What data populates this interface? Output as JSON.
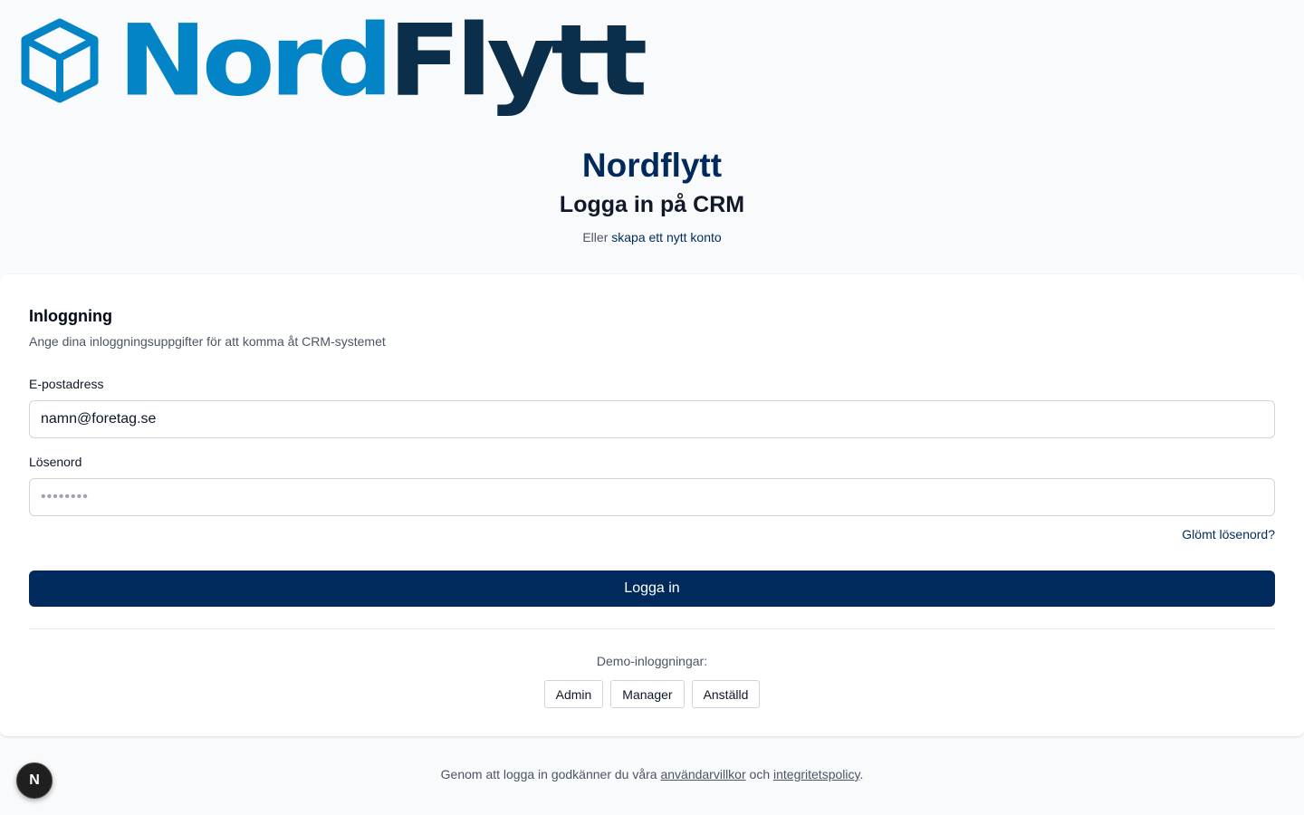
{
  "brand": {
    "logo_part1": "Nord",
    "logo_part2": "Flytt",
    "logo_icon": "cube-icon",
    "color_primary": "#0284c7",
    "color_secondary": "#0b2f4a"
  },
  "hero": {
    "title": "Nordflytt",
    "subtitle": "Logga in på CRM",
    "prefix": "Eller",
    "signup_link": "skapa ett nytt konto"
  },
  "card": {
    "title": "Inloggning",
    "description": "Ange dina inloggningsuppgifter för att komma åt CRM-systemet",
    "email_label": "E-postadress",
    "email_value": "namn@foretag.se",
    "password_label": "Lösenord",
    "password_placeholder": "••••••••",
    "forgot_link": "Glömt lösenord?",
    "submit_label": "Logga in",
    "demo_label": "Demo-inloggningar:",
    "demo_buttons": [
      "Admin",
      "Manager",
      "Anställd"
    ]
  },
  "footer": {
    "text_before": "Genom att logga in godkänner du våra",
    "terms_link": "användarvillkor",
    "text_middle": "och",
    "privacy_link": "integritetspolicy",
    "text_after": "."
  },
  "dev_badge": {
    "label": "N",
    "icon": "nextjs-icon"
  },
  "colors": {
    "accent": "#002a5c",
    "background": "#f8fafc"
  }
}
